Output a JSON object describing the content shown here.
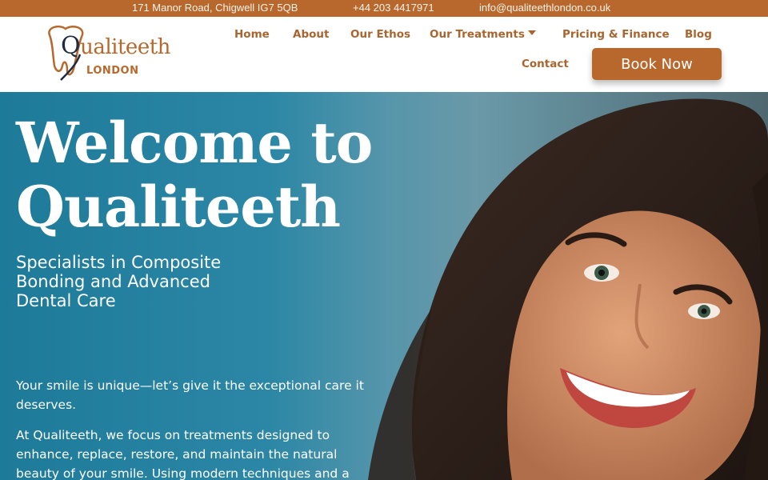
{
  "topbar": {
    "address": "171 Manor Road, Chigwell IG7 5QB",
    "phone": "+44 203 4417971",
    "email": "info@qualiteethlondon.co.uk"
  },
  "logo": {
    "brand_initial": "Q",
    "brand_rest": "ualiteeth",
    "subtitle": "LONDON"
  },
  "nav": {
    "items": [
      "Home",
      "About",
      "Our Ethos",
      "Our Treatments",
      "Pricing & Finance",
      "Blog",
      "Contact"
    ],
    "cta": "Book Now"
  },
  "hero": {
    "title_line1": "Welcome to",
    "title_line2": "Qualiteeth",
    "subtitle": "Specialists in Composite Bonding and Advanced Dental Care",
    "paragraph1": "Your smile is unique—let’s give it the exceptional care it deserves.",
    "paragraph2": "At Qualiteeth, we focus on treatments designed to enhance, replace, restore, and maintain the natural beauty of your smile. Using modern techniques and a"
  },
  "colors": {
    "brand": "#b8682c",
    "navy": "#1f2c3e",
    "hero_blue": "#2b87a5"
  }
}
